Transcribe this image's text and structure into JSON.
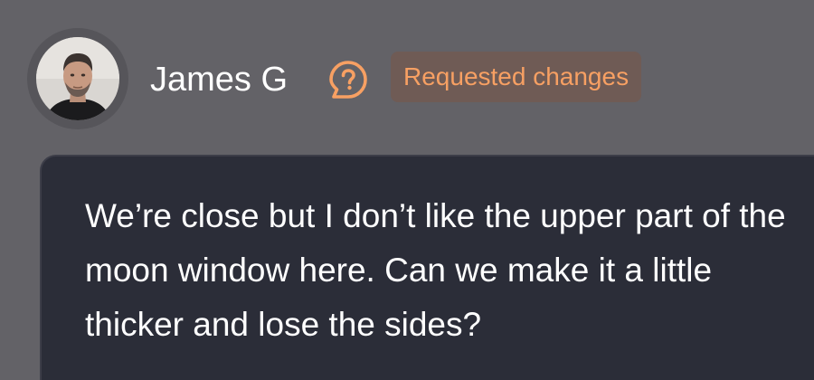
{
  "comment": {
    "author": {
      "name": "James G",
      "avatar_icon": "user-avatar-photo"
    },
    "status": {
      "icon": "question-chat-bubble-icon",
      "label": "Requested changes",
      "color": "#f7a063",
      "badge_background": "#6f5b55"
    },
    "body": "We’re close but I don’t like the upper part of the moon window here. Can we make it a little thicker and lose the sides?"
  },
  "colors": {
    "page_background": "#636267",
    "card_background": "#2b2d38",
    "text": "#ffffff"
  }
}
